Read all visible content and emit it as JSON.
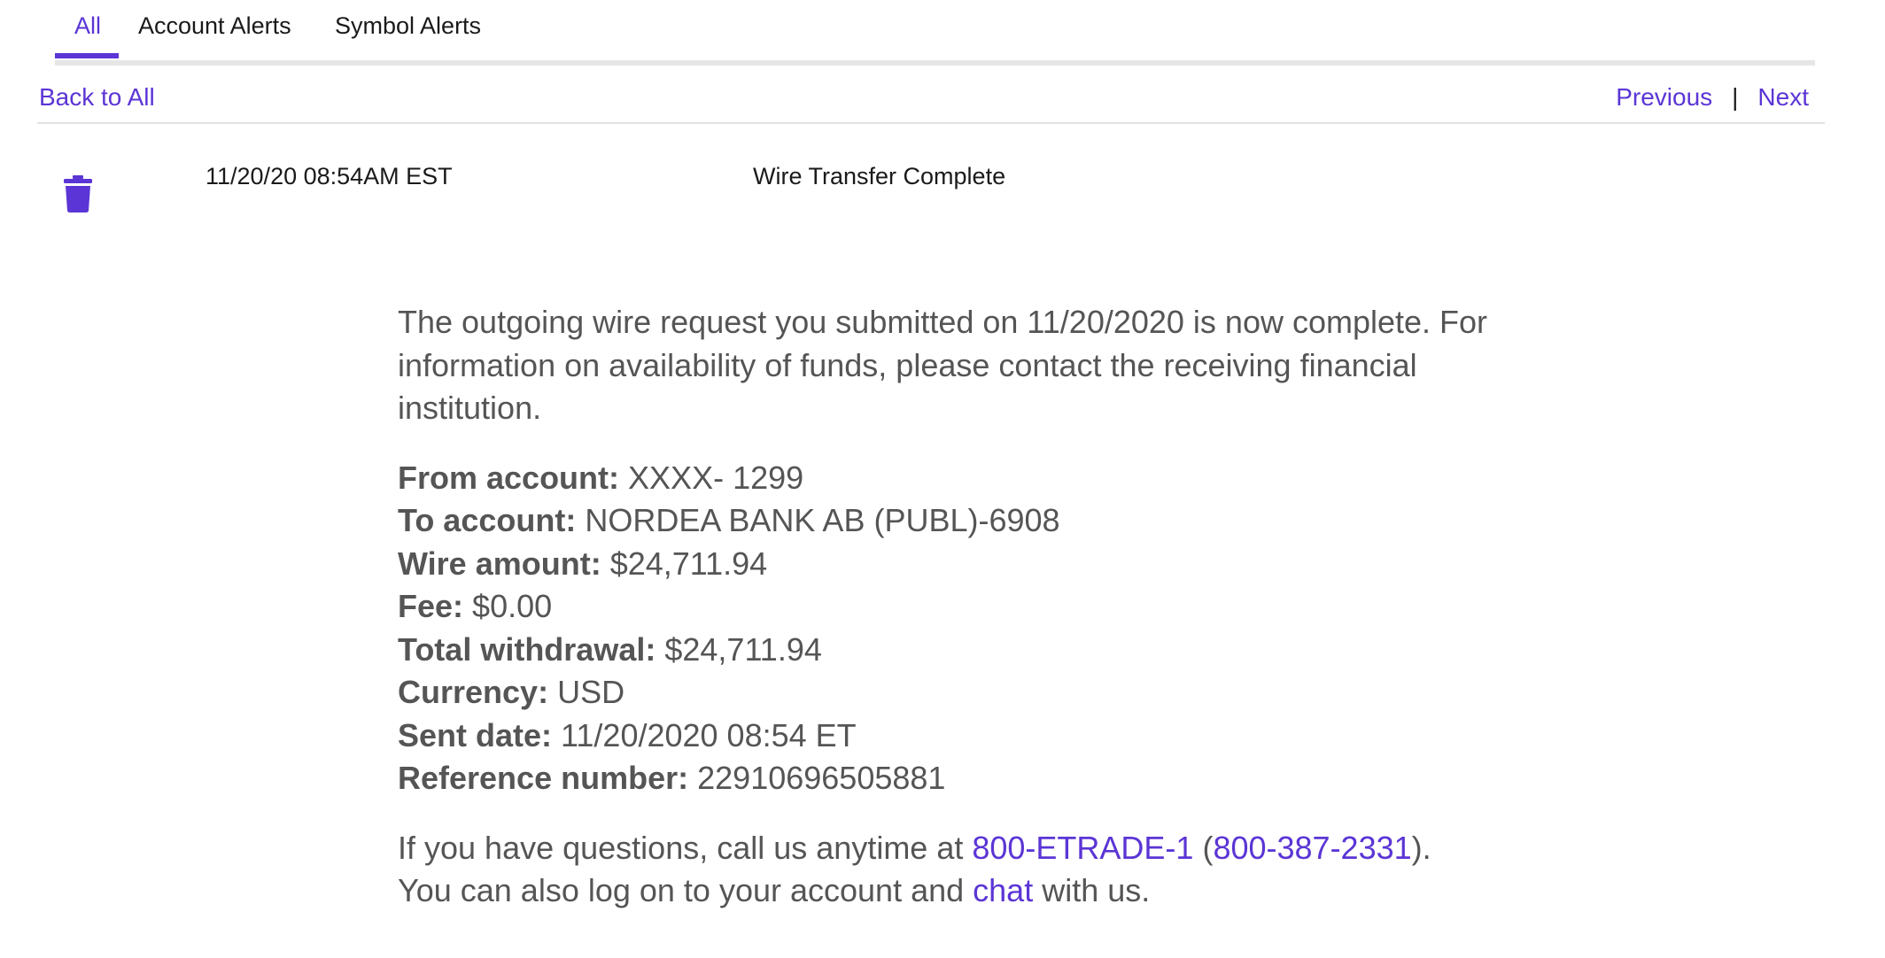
{
  "tabs": [
    {
      "label": "All",
      "active": true
    },
    {
      "label": "Account Alerts",
      "active": false
    },
    {
      "label": "Symbol Alerts",
      "active": false
    }
  ],
  "nav": {
    "back_label": "Back to All",
    "previous_label": "Previous",
    "separator": "|",
    "next_label": "Next"
  },
  "message": {
    "icon": "trash-icon",
    "date": "11/20/20 08:54AM EST",
    "subject": "Wire Transfer Complete",
    "intro": "The outgoing wire request you submitted on 11/20/2020 is now complete. For information on availability of funds, please contact the receiving financial institution.",
    "details": [
      {
        "label": "From account:",
        "value": "XXXX- 1299"
      },
      {
        "label": "To account:",
        "value": "NORDEA BANK AB (PUBL)-6908"
      },
      {
        "label": "Wire amount:",
        "value": "$24,711.94"
      },
      {
        "label": "Fee:",
        "value": "$0.00"
      },
      {
        "label": "Total withdrawal:",
        "value": "$24,711.94"
      },
      {
        "label": "Currency:",
        "value": "USD"
      },
      {
        "label": "Sent date:",
        "value": "11/20/2020 08:54 ET"
      },
      {
        "label": "Reference number:",
        "value": "22910696505881"
      }
    ],
    "questions": {
      "prefix": "If you have questions, call us anytime at ",
      "phone_text": "800-ETRADE-1",
      "paren_open": " (",
      "phone_number": "800-387-2331",
      "paren_close": ").",
      "line2_prefix": "You can also log on to your account and ",
      "chat_link": "chat",
      "line2_suffix": " with us."
    }
  },
  "colors": {
    "accent": "#5b35d5",
    "text": "#555555",
    "dark_text": "#1a1a1a"
  }
}
